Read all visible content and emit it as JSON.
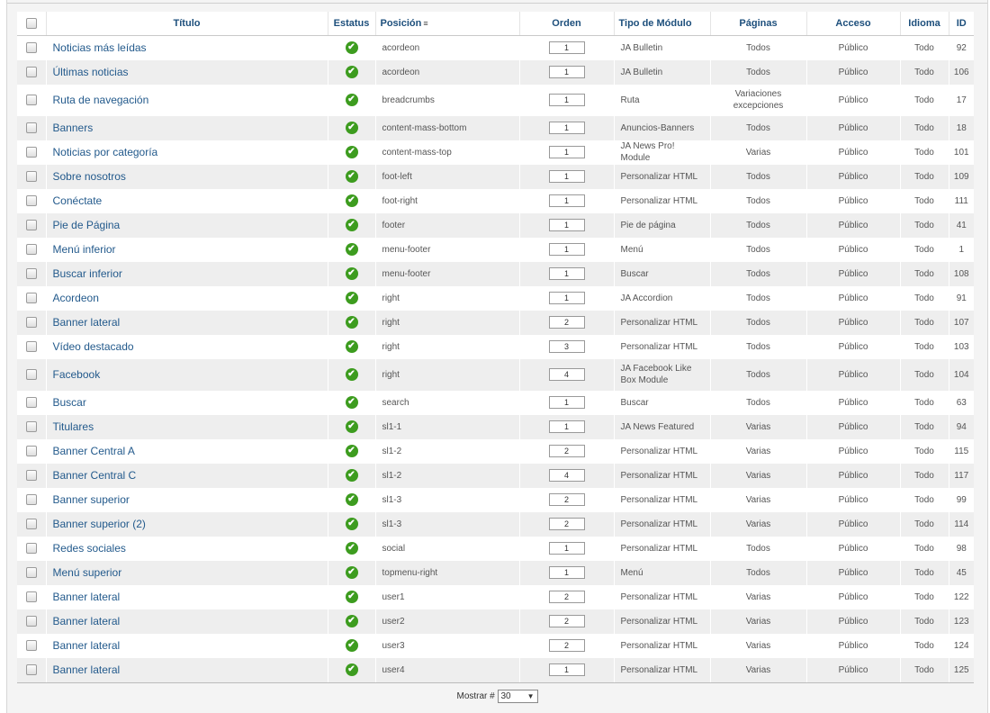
{
  "columns": {
    "title": "Título",
    "status": "Estatus",
    "position": "Posición",
    "order": "Orden",
    "type": "Tipo de Módulo",
    "pages": "Páginas",
    "access": "Acceso",
    "language": "Idioma",
    "id": "ID"
  },
  "rows": [
    {
      "title": "Noticias más leídas",
      "position": "acordeon",
      "order": "1",
      "type": "JA Bulletin",
      "pages": "Todos",
      "access": "Público",
      "language": "Todo",
      "id": "92"
    },
    {
      "title": "Últimas noticias",
      "position": "acordeon",
      "order": "1",
      "type": "JA Bulletin",
      "pages": "Todos",
      "access": "Público",
      "language": "Todo",
      "id": "106"
    },
    {
      "title": "Ruta de navegación",
      "position": "breadcrumbs",
      "order": "1",
      "type": "Ruta",
      "pages": "Variaciones excepciones",
      "access": "Público",
      "language": "Todo",
      "id": "17",
      "tall": true
    },
    {
      "title": "Banners",
      "position": "content-mass-bottom",
      "order": "1",
      "type": "Anuncios-Banners",
      "pages": "Todos",
      "access": "Público",
      "language": "Todo",
      "id": "18"
    },
    {
      "title": "Noticias por categoría",
      "position": "content-mass-top",
      "order": "1",
      "type": "JA News Pro! Module",
      "pages": "Varias",
      "access": "Público",
      "language": "Todo",
      "id": "101"
    },
    {
      "title": "Sobre nosotros",
      "position": "foot-left",
      "order": "1",
      "type": "Personalizar HTML",
      "pages": "Todos",
      "access": "Público",
      "language": "Todo",
      "id": "109"
    },
    {
      "title": "Conéctate",
      "position": "foot-right",
      "order": "1",
      "type": "Personalizar HTML",
      "pages": "Todos",
      "access": "Público",
      "language": "Todo",
      "id": "111"
    },
    {
      "title": "Pie de Página",
      "position": "footer",
      "order": "1",
      "type": "Pie de página",
      "pages": "Todos",
      "access": "Público",
      "language": "Todo",
      "id": "41"
    },
    {
      "title": "Menú inferior",
      "position": "menu-footer",
      "order": "1",
      "type": "Menú",
      "pages": "Todos",
      "access": "Público",
      "language": "Todo",
      "id": "1"
    },
    {
      "title": "Buscar inferior",
      "position": "menu-footer",
      "order": "1",
      "type": "Buscar",
      "pages": "Todos",
      "access": "Público",
      "language": "Todo",
      "id": "108"
    },
    {
      "title": "Acordeon",
      "position": "right",
      "order": "1",
      "type": "JA Accordion",
      "pages": "Todos",
      "access": "Público",
      "language": "Todo",
      "id": "91"
    },
    {
      "title": "Banner lateral",
      "position": "right",
      "order": "2",
      "type": "Personalizar HTML",
      "pages": "Todos",
      "access": "Público",
      "language": "Todo",
      "id": "107"
    },
    {
      "title": "Vídeo destacado",
      "position": "right",
      "order": "3",
      "type": "Personalizar HTML",
      "pages": "Todos",
      "access": "Público",
      "language": "Todo",
      "id": "103"
    },
    {
      "title": "Facebook",
      "position": "right",
      "order": "4",
      "type": "JA Facebook Like Box Module",
      "pages": "Todos",
      "access": "Público",
      "language": "Todo",
      "id": "104",
      "tall": true
    },
    {
      "title": "Buscar",
      "position": "search",
      "order": "1",
      "type": "Buscar",
      "pages": "Todos",
      "access": "Público",
      "language": "Todo",
      "id": "63"
    },
    {
      "title": "Titulares",
      "position": "sl1-1",
      "order": "1",
      "type": "JA News Featured",
      "pages": "Varias",
      "access": "Público",
      "language": "Todo",
      "id": "94"
    },
    {
      "title": "Banner Central A",
      "position": "sl1-2",
      "order": "2",
      "type": "Personalizar HTML",
      "pages": "Varias",
      "access": "Público",
      "language": "Todo",
      "id": "115"
    },
    {
      "title": "Banner Central C",
      "position": "sl1-2",
      "order": "4",
      "type": "Personalizar HTML",
      "pages": "Varias",
      "access": "Público",
      "language": "Todo",
      "id": "117"
    },
    {
      "title": "Banner superior",
      "position": "sl1-3",
      "order": "2",
      "type": "Personalizar HTML",
      "pages": "Varias",
      "access": "Público",
      "language": "Todo",
      "id": "99"
    },
    {
      "title": "Banner superior (2)",
      "position": "sl1-3",
      "order": "2",
      "type": "Personalizar HTML",
      "pages": "Varias",
      "access": "Público",
      "language": "Todo",
      "id": "114"
    },
    {
      "title": "Redes sociales",
      "position": "social",
      "order": "1",
      "type": "Personalizar HTML",
      "pages": "Todos",
      "access": "Público",
      "language": "Todo",
      "id": "98"
    },
    {
      "title": "Menú superior",
      "position": "topmenu-right",
      "order": "1",
      "type": "Menú",
      "pages": "Todos",
      "access": "Público",
      "language": "Todo",
      "id": "45"
    },
    {
      "title": "Banner lateral",
      "position": "user1",
      "order": "2",
      "type": "Personalizar HTML",
      "pages": "Varias",
      "access": "Público",
      "language": "Todo",
      "id": "122"
    },
    {
      "title": "Banner lateral",
      "position": "user2",
      "order": "2",
      "type": "Personalizar HTML",
      "pages": "Varias",
      "access": "Público",
      "language": "Todo",
      "id": "123"
    },
    {
      "title": "Banner lateral",
      "position": "user3",
      "order": "2",
      "type": "Personalizar HTML",
      "pages": "Varias",
      "access": "Público",
      "language": "Todo",
      "id": "124"
    },
    {
      "title": "Banner lateral",
      "position": "user4",
      "order": "1",
      "type": "Personalizar HTML",
      "pages": "Varias",
      "access": "Público",
      "language": "Todo",
      "id": "125"
    }
  ],
  "footer": {
    "show_label": "Mostrar #",
    "show_value": "30"
  },
  "icons": {
    "status": "published-check-icon",
    "sort": "sort-ascending-icon"
  },
  "colors": {
    "link": "#235a8c",
    "header_text": "#1d4f7c",
    "published": "#3d9c1f"
  }
}
